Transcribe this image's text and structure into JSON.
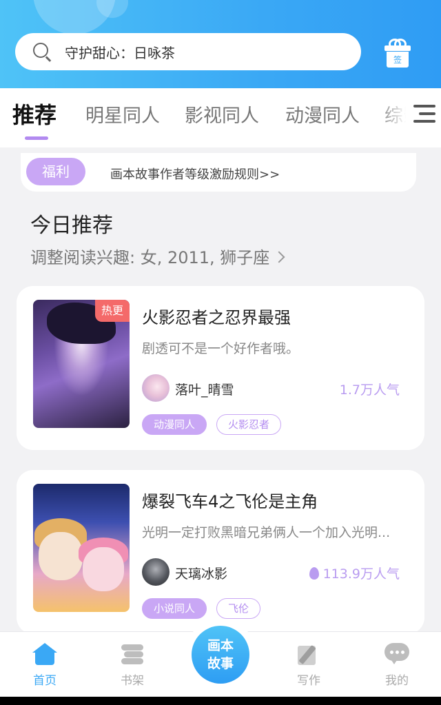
{
  "search": {
    "text": "守护甜心：日咏茶",
    "icon": "search-icon"
  },
  "checkin": {
    "label": "签",
    "icon": "gift-icon"
  },
  "tabs": [
    {
      "label": "推荐",
      "active": true
    },
    {
      "label": "明星同人",
      "active": false
    },
    {
      "label": "影视同人",
      "active": false
    },
    {
      "label": "动漫同人",
      "active": false
    },
    {
      "label": "综影",
      "active": false
    }
  ],
  "notice": {
    "tag": "福利",
    "text": "画本故事作者等级激励规则>>"
  },
  "section": {
    "title": "今日推荐",
    "subtitle": "调整阅读兴趣: 女, 2011, 狮子座"
  },
  "books": [
    {
      "badge": "热更",
      "title": "火影忍者之忍界最强",
      "desc": "剧透可不是一个好作者哦。",
      "author": "落叶_晴雪",
      "popularity": "1.7万人气",
      "tags": [
        "动漫同人",
        "火影忍者"
      ]
    },
    {
      "title": "爆裂飞车4之飞伦是主角",
      "desc": "光明一定打败黑暗兄弟俩人一个加入光明...",
      "author": "天璃冰影",
      "popularity": "113.9万人气",
      "tags": [
        "小说同人",
        "飞伦"
      ]
    }
  ],
  "bottom_nav": {
    "home": "首页",
    "shelf": "书架",
    "center_line1": "画本",
    "center_line2": "故事",
    "write": "写作",
    "mine": "我的"
  },
  "colors": {
    "accent": "#3aa8f5",
    "purple": "#c9a7f5",
    "hot": "#f46a6a"
  }
}
